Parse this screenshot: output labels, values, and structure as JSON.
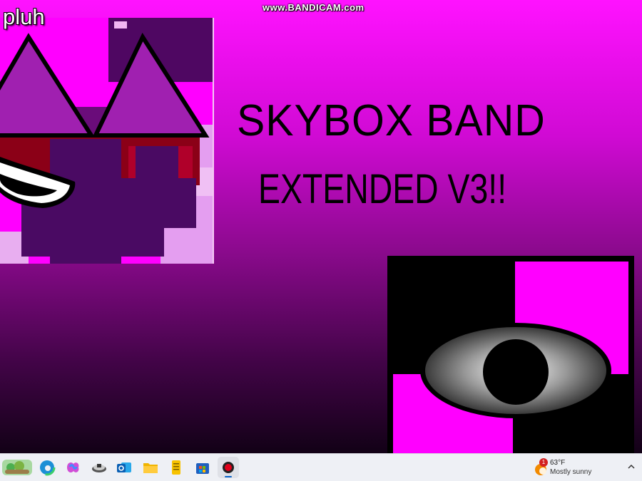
{
  "screen": {
    "watermark": "www.BANDICAM.com",
    "user_label": "pluh",
    "title_line1": "SKYBOX BAND",
    "title_line2": "EXTENDED V3!!"
  },
  "taskbar": {
    "apps": [
      {
        "name": "widgets-icon"
      },
      {
        "name": "edge-icon"
      },
      {
        "name": "copilot-icon"
      },
      {
        "name": "game-icon"
      },
      {
        "name": "outlook-icon"
      },
      {
        "name": "file-explorer-icon"
      },
      {
        "name": "notes-icon"
      },
      {
        "name": "store-icon"
      },
      {
        "name": "bandicam-icon"
      }
    ],
    "weather": {
      "badge": "1",
      "temperature": "63°F",
      "condition": "Mostly sunny"
    }
  },
  "colors": {
    "magenta": "#ff12ff",
    "deep_purple": "#4a0a63",
    "taskbar": "#eef0f5"
  }
}
